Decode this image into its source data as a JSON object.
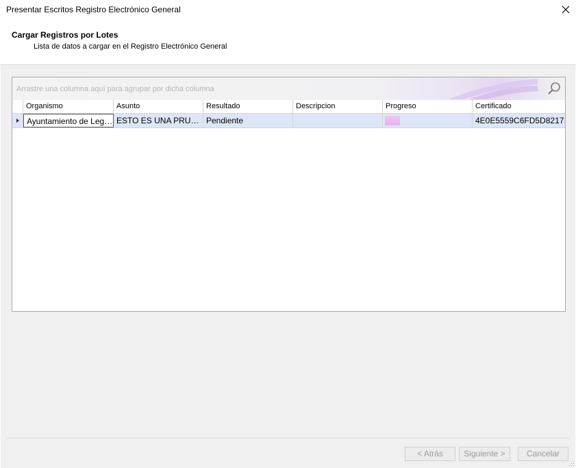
{
  "window": {
    "title": "Presentar Escritos Registro Electrónico General"
  },
  "header": {
    "title": "Cargar Registros por Lotes",
    "subtitle": "Lista de datos a cargar en el Registro Electrónico General"
  },
  "grid": {
    "group_hint": "Arrastre una columna aquí para agrupar por dicha columna",
    "columns": [
      "Organismo",
      "Asunto",
      "Resultado",
      "Descripcion",
      "Progreso",
      "Certificado"
    ],
    "rows": [
      {
        "organismo": "Ayuntamiento de Leganés",
        "asunto": "ESTO ES UNA PRUEB...",
        "resultado": "Pendiente",
        "descripcion": "",
        "progreso": 0.18,
        "certificado": "4E0E5559C6FD5D8217"
      }
    ]
  },
  "buttons": {
    "back": "< Atrás",
    "next": "Siguiente >",
    "cancel": "Cancelar"
  },
  "icons": {
    "close": "close-icon",
    "search": "search-icon",
    "row_indicator": "triangle-right-icon",
    "grip": "resize-grip-icon"
  },
  "colors": {
    "selected_row": "#dde6f7",
    "progress": "#e6b0ec",
    "accent_gradient": "#e3d7f1"
  }
}
